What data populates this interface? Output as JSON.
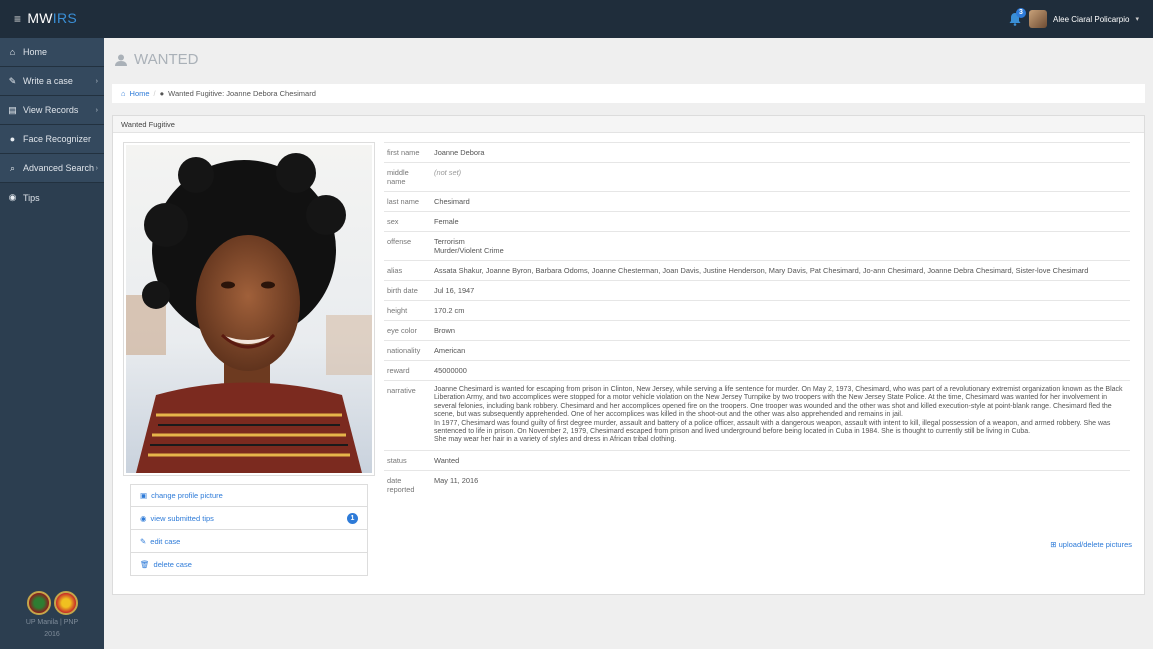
{
  "app": {
    "brand_mw": "MW",
    "brand_irs": "IRS",
    "menu_glyph": "≡"
  },
  "user": {
    "name": "Alee Ciaral Policarpio",
    "caret": "▾",
    "notification_count": "3"
  },
  "sidebar": {
    "items": [
      {
        "label": "Home",
        "icon": "home-icon",
        "glyph": "⌂",
        "chevron": ""
      },
      {
        "label": "Write a case",
        "icon": "edit-icon",
        "glyph": "✎",
        "chevron": "›"
      },
      {
        "label": "View Records",
        "icon": "records-icon",
        "glyph": "▤",
        "chevron": "›"
      },
      {
        "label": "Face Recognizer",
        "icon": "user-icon",
        "glyph": "●",
        "chevron": ""
      },
      {
        "label": "Advanced Search",
        "icon": "search-icon",
        "glyph": "⌕",
        "chevron": "›"
      },
      {
        "label": "Tips",
        "icon": "eye-icon",
        "glyph": "◉",
        "chevron": ""
      }
    ],
    "footer_line1": "UP Manila | PNP",
    "footer_line2": "2016"
  },
  "page": {
    "title": "WANTED"
  },
  "breadcrumb": {
    "home": "Home",
    "current": "Wanted Fugitive: Joanne Debora Chesimard"
  },
  "panel": {
    "heading": "Wanted Fugitive"
  },
  "details": [
    {
      "key": "first name",
      "value": "Joanne Debora"
    },
    {
      "key": "middle name",
      "value": "(not set)"
    },
    {
      "key": "last name",
      "value": "Chesimard"
    },
    {
      "key": "sex",
      "value": "Female"
    },
    {
      "key": "offense",
      "value": "Terrorism\nMurder/Violent Crime"
    },
    {
      "key": "alias",
      "value": "Assata Shakur, Joanne Byron, Barbara Odoms, Joanne Chesterman, Joan Davis, Justine Henderson, Mary Davis, Pat Chesimard, Jo-ann Chesimard, Joanne Debra Chesimard, Sister-love Chesimard"
    },
    {
      "key": "birth date",
      "value": "Jul 16, 1947"
    },
    {
      "key": "height",
      "value": "170.2 cm"
    },
    {
      "key": "eye color",
      "value": "Brown"
    },
    {
      "key": "nationality",
      "value": "American"
    },
    {
      "key": "reward",
      "value": "45000000"
    },
    {
      "key": "narrative",
      "value": "Joanne Chesimard is wanted for escaping from prison in Clinton, New Jersey, while serving a life sentence for murder. On May 2, 1973, Chesimard, who was part of a revolutionary extremist organization known as the Black Liberation Army, and two accomplices were stopped for a motor vehicle violation on the New Jersey Turnpike by two troopers with the New Jersey State Police. At the time, Chesimard was wanted for her involvement in several felonies, including bank robbery. Chesimard and her accomplices opened fire on the troopers. One trooper was wounded and the other was shot and killed execution-style at point-blank range. Chesimard fled the scene, but was subsequently apprehended. One of her accomplices was killed in the shoot-out and the other was also apprehended and remains in jail.\nIn 1977, Chesimard was found guilty of first degree murder, assault and battery of a police officer, assault with a dangerous weapon, assault with intent to kill, illegal possession of a weapon, and armed robbery. She was sentenced to life in prison. On November 2, 1979, Chesimard escaped from prison and lived underground before being located in Cuba in 1984. She is thought to currently still be living in Cuba.\nShe may wear her hair in a variety of styles and dress in African tribal clothing."
    },
    {
      "key": "status",
      "value": "Wanted"
    },
    {
      "key": "date reported",
      "value": "May 11, 2016"
    }
  ],
  "actions": {
    "change_picture": "change profile picture",
    "view_tips": "view submitted tips",
    "tips_count": "1",
    "edit_case": "edit case",
    "delete_case": "delete case"
  },
  "upload_link": "upload/delete pictures"
}
